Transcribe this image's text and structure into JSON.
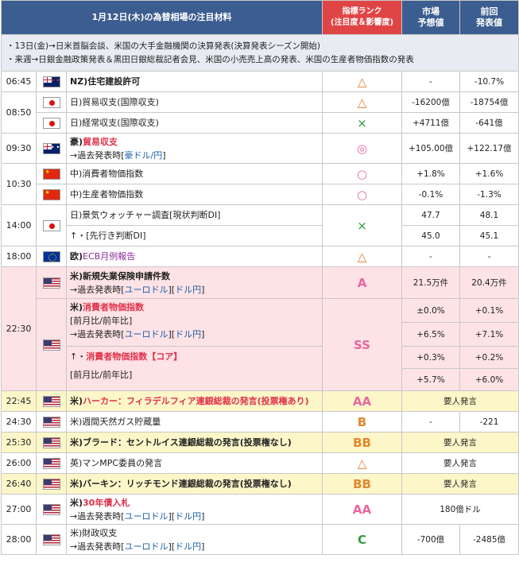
{
  "header": {
    "title": "1月12日(木)の為替相場の注目材料",
    "rank_label": "指標ランク\n(注目度＆影響度)",
    "forecast_label": "市場\n予想値",
    "previous_label": "前回\n発表値"
  },
  "notes": [
    "・13日(金)→日米首脳会談、米国の大手金融機関の決算発表(決算発表シーズン開始)",
    "・来週→日銀金融政策発表＆黒田日銀総裁記者会見、米国の小売売上高の発表、米国の生産者物価指数の発表"
  ],
  "rows": {
    "r1": {
      "time": "06:45",
      "flag": "nz",
      "ev": "NZ)住宅建設許可",
      "rank": "△",
      "fc": "-",
      "pv": "-10.7%"
    },
    "r2a": {
      "time": "08:50",
      "flag": "jp",
      "ev": "日)貿易収支(国際収支)",
      "rank": "△",
      "fc": "-16200億",
      "pv": "-18754億"
    },
    "r2b": {
      "flag": "jp",
      "ev": "日)経常収支(国際収支)",
      "rank": "×",
      "fc": "+4711億",
      "pv": "-641億"
    },
    "r3": {
      "time": "09:30",
      "flag": "au",
      "ev_pre": "豪)",
      "ev_red": "貿易収支",
      "ev2_pre": "→過去発表時[",
      "ev2_link": "豪ドル/円",
      "ev2_post": "]",
      "rank": "◎",
      "fc": "+105.00億",
      "pv": "+122.17億"
    },
    "r4a": {
      "time": "10:30",
      "flag": "cn",
      "ev": "中)消費者物価指数",
      "rank": "○",
      "fc": "+1.8%",
      "pv": "+1.6%"
    },
    "r4b": {
      "flag": "cn",
      "ev": "中)生産者物価指数",
      "rank": "○",
      "fc": "-0.1%",
      "pv": "-1.3%"
    },
    "r5": {
      "time": "14:00",
      "flag": "jp",
      "ev": "日)景気ウォッチャー調査[現状判断DI]",
      "ev2": "↑・[先行き判断DI]",
      "rank": "×",
      "fc": "47.7",
      "pv": "48.1",
      "fc2": "45.0",
      "pv2": "45.1"
    },
    "r6": {
      "time": "18:00",
      "flag": "eu",
      "ev_pre": "欧)",
      "ev_purple": "ECB月例報告",
      "rank": "△",
      "fc": "-",
      "pv": "-"
    },
    "r7": {
      "time": "22:30",
      "flag": "us",
      "ev": "米)新規失業保険申請件数",
      "ev2_pre": "→過去発表時[",
      "ev2_link1": "ユーロドル",
      "ev2_link2": "ドル円",
      "ev2_post": "]",
      "rank": "A",
      "fc": "21.5万件",
      "pv": "20.4万件"
    },
    "r8": {
      "flag": "us",
      "ev_pre": "米)",
      "ev_red": "消費者物価指数",
      "ev2": "[前月比/前年比]",
      "ev3_pre": "→過去発表時[",
      "ev3_link1": "ユーロドル",
      "ev3_link2": "ドル円",
      "ev3_post": "]",
      "ev4_pre": "↑・",
      "ev4_red": "消費者物価指数【コア】",
      "ev5": "[前月比/前年比]",
      "rank": "SS",
      "fc": "±0.0%",
      "pv": "+0.1%",
      "fc2": "+6.5%",
      "pv2": "+7.1%",
      "fc3": "+0.3%",
      "pv3": "+0.2%",
      "fc4": "+5.7%",
      "pv4": "+6.0%"
    },
    "r9": {
      "time": "22:45",
      "flag": "us",
      "ev_pre": "米)",
      "ev_red": "ハーカー：フィラデルフィア連銀総裁の発言(投票権あり)",
      "rank": "AA",
      "merged": "要人発言"
    },
    "r10": {
      "time": "24:30",
      "flag": "us",
      "ev": "米)週間天然ガス貯蔵量",
      "rank": "B",
      "fc": "-",
      "pv": "-221"
    },
    "r11": {
      "time": "25:30",
      "flag": "us",
      "ev": "米)ブラード：セントルイス連銀総裁の発言(投票権なし)",
      "rank": "BB",
      "merged": "要人発言"
    },
    "r12": {
      "time": "26:00",
      "flag": "uk",
      "ev": "英)マンMPC委員の発言",
      "rank": "△",
      "merged": "要人発言"
    },
    "r13": {
      "time": "26:40",
      "flag": "us",
      "ev": "米)バーキン：リッチモンド連銀総裁の発言(投票権なし)",
      "rank": "BB",
      "merged": "要人発言"
    },
    "r14": {
      "time": "27:00",
      "flag": "us",
      "ev_pre": "米)",
      "ev_red": "30年債入札",
      "ev2_pre": "→過去発表時[",
      "ev2_link1": "ユーロドル",
      "ev2_link2": "ドル円",
      "ev2_post": "]",
      "rank": "AA",
      "merged": "180億ドル"
    },
    "r15": {
      "time": "28:00",
      "flag": "us",
      "ev": "米)財政収支",
      "ev2_pre": "→過去発表時[",
      "ev2_link1": "ユーロドル",
      "ev2_link2": "ドル円",
      "ev2_post": "]",
      "rank": "C",
      "fc": "-700億",
      "pv": "-2485億"
    }
  }
}
